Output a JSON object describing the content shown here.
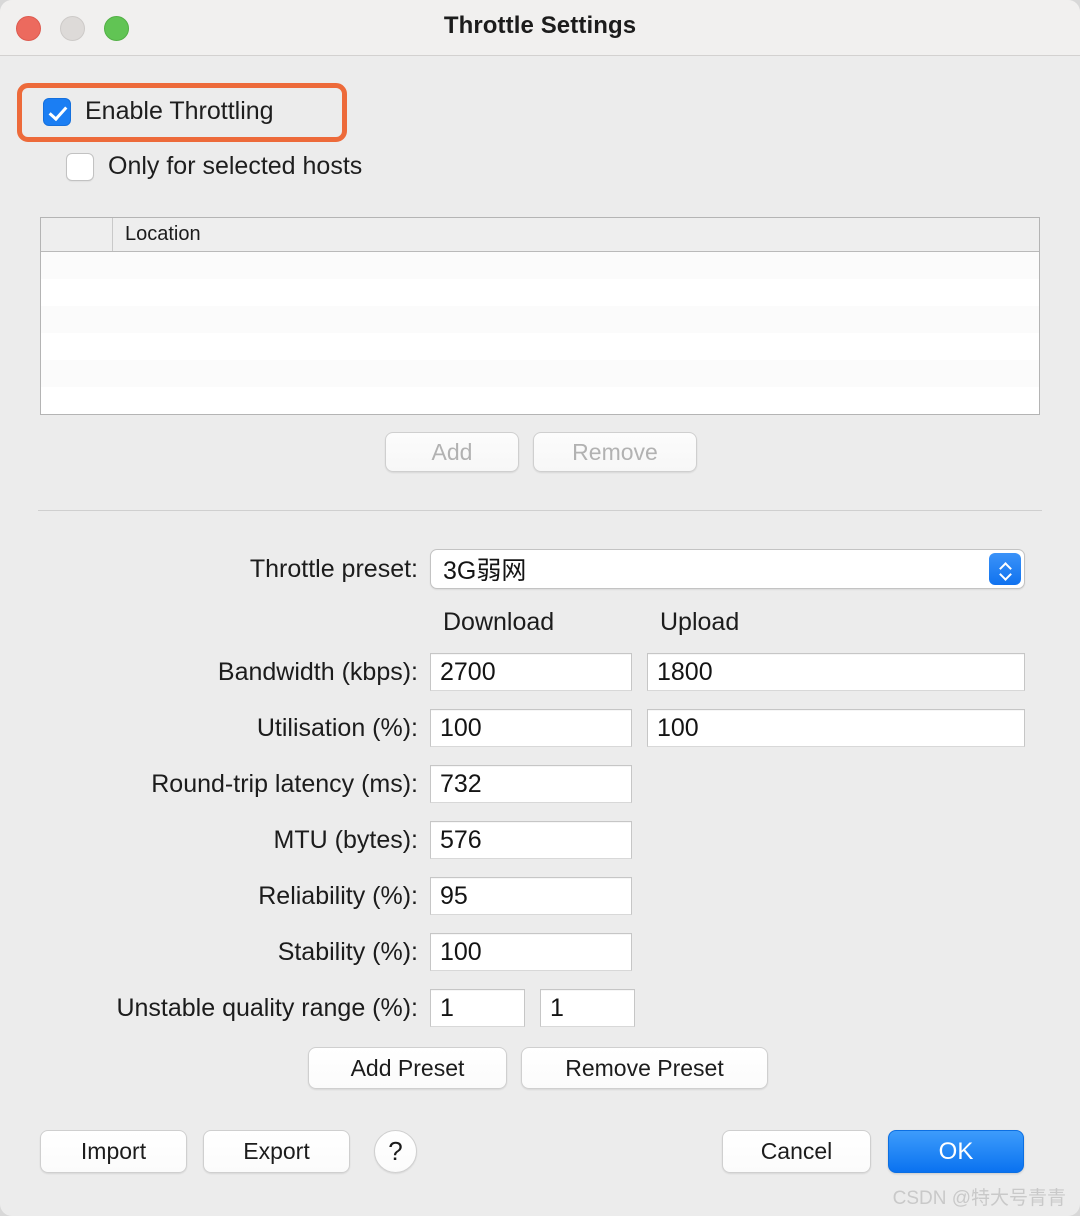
{
  "window": {
    "title": "Throttle Settings",
    "traffic_lights": [
      "close",
      "minimize",
      "zoom"
    ]
  },
  "options": {
    "enable_throttling": {
      "label": "Enable Throttling",
      "checked": true,
      "highlighted": true
    },
    "only_selected_hosts": {
      "label": "Only for selected hosts",
      "checked": false
    }
  },
  "hosts_table": {
    "columns": [
      "",
      "Location"
    ],
    "rows": []
  },
  "table_buttons": {
    "add": "Add",
    "remove": "Remove",
    "add_enabled": false,
    "remove_enabled": false
  },
  "preset": {
    "label": "Throttle preset:",
    "value": "3G弱网"
  },
  "columns": {
    "download": "Download",
    "upload": "Upload"
  },
  "fields": [
    {
      "label": "Bandwidth (kbps):",
      "download": "2700",
      "upload": "1800"
    },
    {
      "label": "Utilisation (%):",
      "download": "100",
      "upload": "100"
    },
    {
      "label": "Round-trip latency (ms):",
      "download": "732",
      "upload": null
    },
    {
      "label": "MTU (bytes):",
      "download": "576",
      "upload": null
    },
    {
      "label": "Reliability (%):",
      "download": "95",
      "upload": null
    },
    {
      "label": "Stability (%):",
      "download": "100",
      "upload": null
    },
    {
      "label": "Unstable quality range (%):",
      "download": "1",
      "upload": "1"
    }
  ],
  "preset_buttons": {
    "add": "Add Preset",
    "remove": "Remove Preset"
  },
  "footer": {
    "import": "Import",
    "export": "Export",
    "help": "?",
    "cancel": "Cancel",
    "ok": "OK"
  },
  "watermark": "CSDN @特大号青青",
  "colors": {
    "highlight": "#ed6a3a",
    "accent": "#1b7ef3",
    "ok_button": "#0a72f0",
    "window_bg": "#ececec",
    "titlebar_bg": "#f1f0ef"
  }
}
